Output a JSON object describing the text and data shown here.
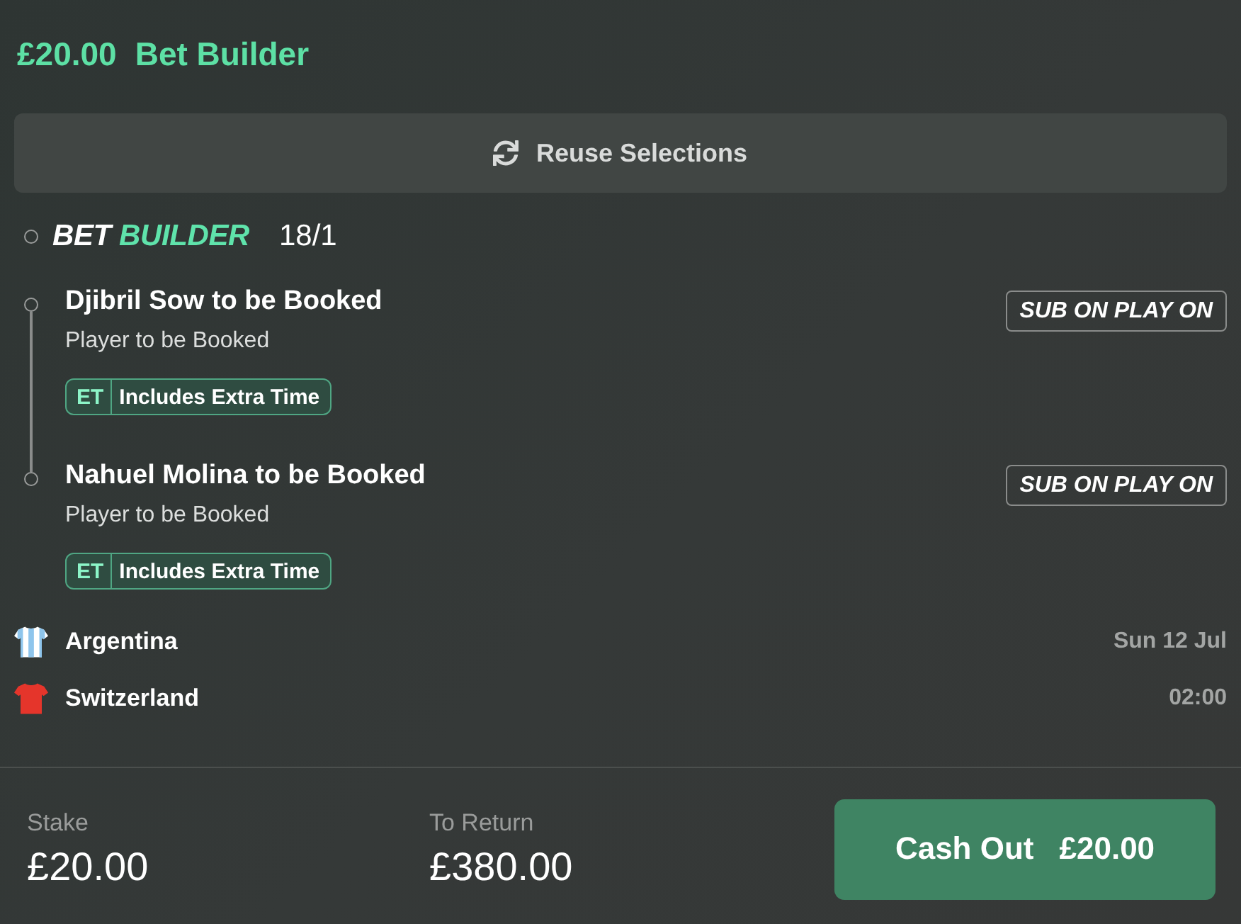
{
  "header": {
    "amount": "£20.00",
    "title": "Bet Builder"
  },
  "reuse_button": {
    "label": "Reuse Selections"
  },
  "bet": {
    "name_prefix": "BET",
    "name_highlight": "BUILDER",
    "odds": "18/1"
  },
  "selections": [
    {
      "title": "Djibril Sow to be Booked",
      "market": "Player to be Booked",
      "tag": {
        "code": "ET",
        "label": "Includes Extra Time"
      },
      "badge": "SUB ON PLAY ON"
    },
    {
      "title": "Nahuel Molina to be Booked",
      "market": "Player to be Booked",
      "tag": {
        "code": "ET",
        "label": "Includes Extra Time"
      },
      "badge": "SUB ON PLAY ON"
    }
  ],
  "event": {
    "teams": [
      {
        "name": "Argentina",
        "kind": "striped",
        "color": "#8ec5ec"
      },
      {
        "name": "Switzerland",
        "kind": "solid",
        "color": "#e5352b"
      }
    ],
    "date": "Sun 12 Jul",
    "time": "02:00"
  },
  "footer": {
    "stake": {
      "label": "Stake",
      "value": "£20.00"
    },
    "to_return": {
      "label": "To Return",
      "value": "£380.00"
    },
    "cash_out": {
      "label": "Cash Out",
      "amount": "£20.00"
    }
  }
}
